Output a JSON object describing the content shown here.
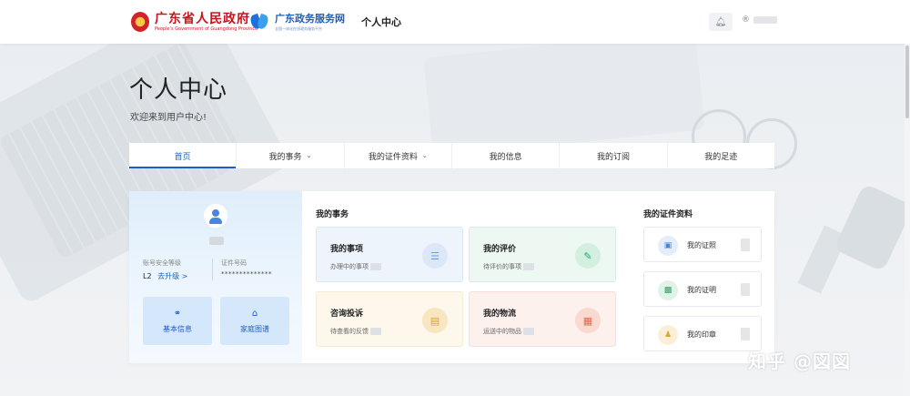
{
  "header": {
    "gov_logo_cn": "广东省人民政府",
    "gov_logo_en": "People's Government of Guangdong Province",
    "service_logo_cn": "广东政务服务网",
    "service_logo_sub": "全国一体化在线政务服务平台",
    "nav_title": "个人中心",
    "user_icon_glyph": "®"
  },
  "hero": {
    "title": "个人中心",
    "subtitle": "欢迎来到用户中心!"
  },
  "tabs": [
    {
      "label": "首页",
      "active": true
    },
    {
      "label": "我的事务",
      "dropdown": true
    },
    {
      "label": "我的证件资料",
      "dropdown": true
    },
    {
      "label": "我的信息"
    },
    {
      "label": "我的订阅"
    },
    {
      "label": "我的足迹"
    }
  ],
  "profile": {
    "security_label": "账号安全等级",
    "security_level": "L2",
    "upgrade_label": "去升级 >",
    "id_label": "证件号码",
    "id_value": "**************",
    "quick_buttons": [
      {
        "label": "基本信息",
        "icon": "user-icon"
      },
      {
        "label": "家庭图谱",
        "icon": "home-icon"
      }
    ]
  },
  "affairs": {
    "title": "我的事务",
    "cards": [
      {
        "title": "我的事项",
        "subtitle": "办理中的事项",
        "icon": "list-icon",
        "color": "#6a9be0",
        "bg": "#eef4fc",
        "icon_bg": "#dce8f8"
      },
      {
        "title": "我的评价",
        "subtitle": "待评价的事项",
        "icon": "edit-icon",
        "color": "#2ea36c",
        "bg": "#eef8f2",
        "icon_bg": "#d3efe0"
      },
      {
        "title": "咨询投诉",
        "subtitle": "待查看的反馈",
        "icon": "message-icon",
        "color": "#d9a43a",
        "bg": "#fdf7ec",
        "icon_bg": "#f8e6c1"
      },
      {
        "title": "我的物流",
        "subtitle": "运送中的物品",
        "icon": "truck-icon",
        "color": "#e06a4e",
        "bg": "#fdf1ee",
        "icon_bg": "#f9d9d0"
      }
    ]
  },
  "documents": {
    "title": "我的证件资料",
    "items": [
      {
        "label": "我的证照",
        "icon": "id-card-icon",
        "color": "#4a86d8",
        "bg": "#e4eefb"
      },
      {
        "label": "我的证明",
        "icon": "certificate-icon",
        "color": "#2ea36c",
        "bg": "#dff3e8"
      },
      {
        "label": "我的印章",
        "icon": "seal-icon",
        "color": "#e0a12e",
        "bg": "#fbefd7"
      }
    ]
  },
  "watermark": "知乎 @図図"
}
